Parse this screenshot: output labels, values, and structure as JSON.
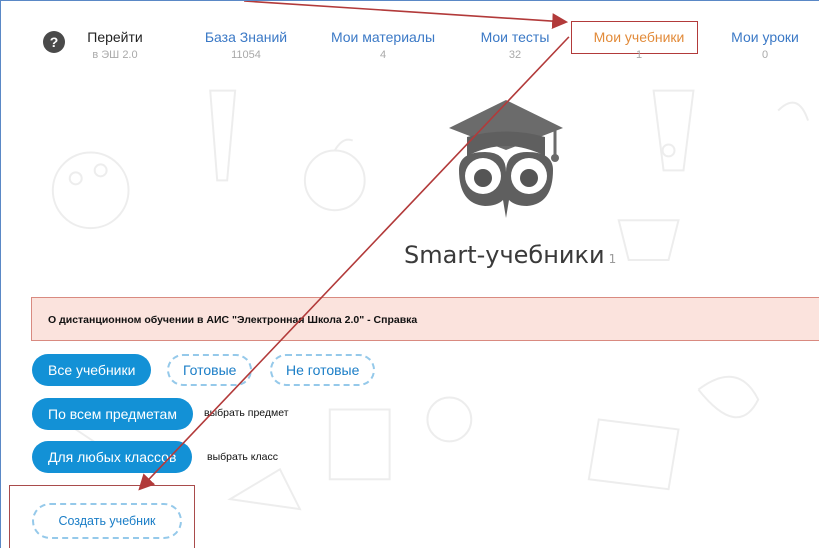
{
  "help": {
    "icon_glyph": "?"
  },
  "nav": {
    "items": [
      {
        "label": "Перейти",
        "count": "в ЭШ 2.0"
      },
      {
        "label": "База Знаний",
        "count": "11054"
      },
      {
        "label": "Мои материалы",
        "count": "4"
      },
      {
        "label": "Мои тесты",
        "count": "32"
      },
      {
        "label": "Мои учебники",
        "count": "1"
      },
      {
        "label": "Мои уроки",
        "count": "0"
      }
    ],
    "active_color": "#e28b3a",
    "link_color": "#3b79c6"
  },
  "hero": {
    "title": "Smart-учебники",
    "count": "1"
  },
  "alert": {
    "text": "О дистанционном обучении в АИС \"Электронная Школа 2.0\" - Справка"
  },
  "filters": {
    "status": {
      "all": "Все учебники",
      "ready": "Готовые",
      "not_ready": "Не готовые"
    },
    "subject": {
      "button": "По всем предметам",
      "hint": "выбрать предмет"
    },
    "grade": {
      "button": "Для любых классов",
      "hint": "выбрать класс"
    }
  },
  "create": {
    "label": "Создать учебник"
  },
  "colors": {
    "primary": "#1391d6",
    "annotation": "#b23a3a",
    "alert_bg": "#fbe3dd"
  }
}
